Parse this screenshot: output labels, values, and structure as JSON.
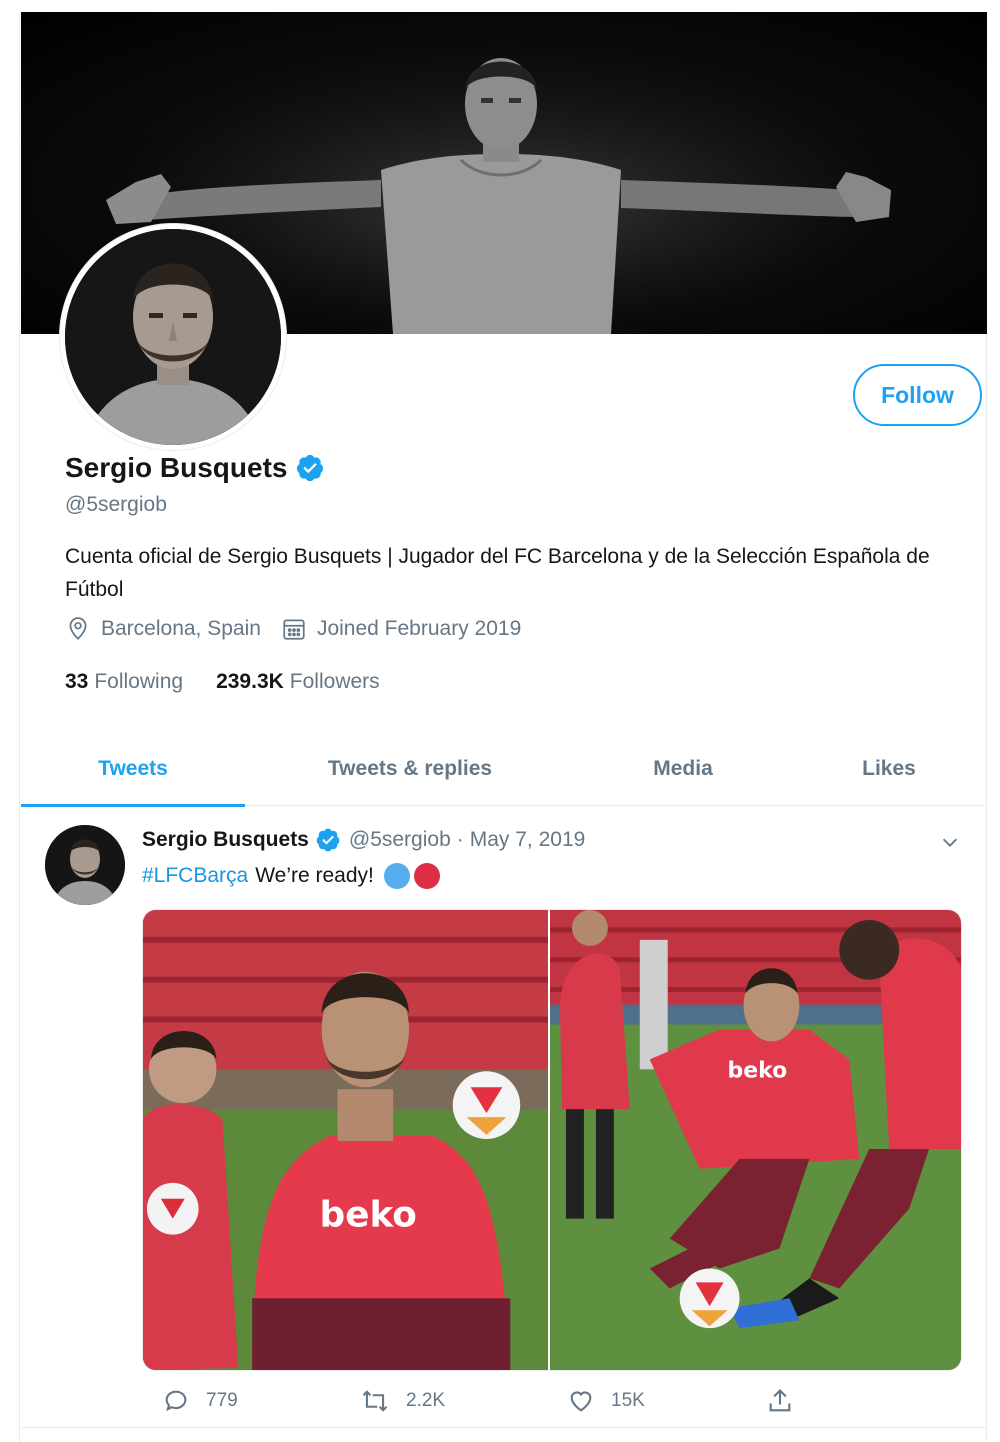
{
  "profile": {
    "display_name": "Sergio Busquets",
    "handle": "@5sergiob",
    "bio": "Cuenta oficial de Sergio Busquets | Jugador del FC Barcelona y de la Selección Española de Fútbol",
    "location": "Barcelona, Spain",
    "joined": "Joined February 2019",
    "following_count": "33",
    "following_label": "Following",
    "followers_count": "239.3K",
    "followers_label": "Followers",
    "follow_button": "Follow"
  },
  "tabs": [
    {
      "label": "Tweets",
      "active": true
    },
    {
      "label": "Tweets & replies",
      "active": false
    },
    {
      "label": "Media",
      "active": false
    },
    {
      "label": "Likes",
      "active": false
    }
  ],
  "tweet": {
    "name": "Sergio Busquets",
    "handle": "@5sergiob",
    "separator": "·",
    "date": "May 7, 2019",
    "hashtag": "#LFCBarça",
    "text": "We’re ready!",
    "emojis": [
      "blue-circle",
      "red-circle"
    ],
    "replies": "779",
    "retweets": "2.2K",
    "likes": "15K"
  },
  "colors": {
    "accent": "#1da1f2",
    "link": "#1b95e0",
    "secondary_text": "#657786",
    "primary_text": "#14171a",
    "border": "#e6ecf0",
    "blue_circle": "#55acee",
    "red_circle": "#dd2e44"
  }
}
